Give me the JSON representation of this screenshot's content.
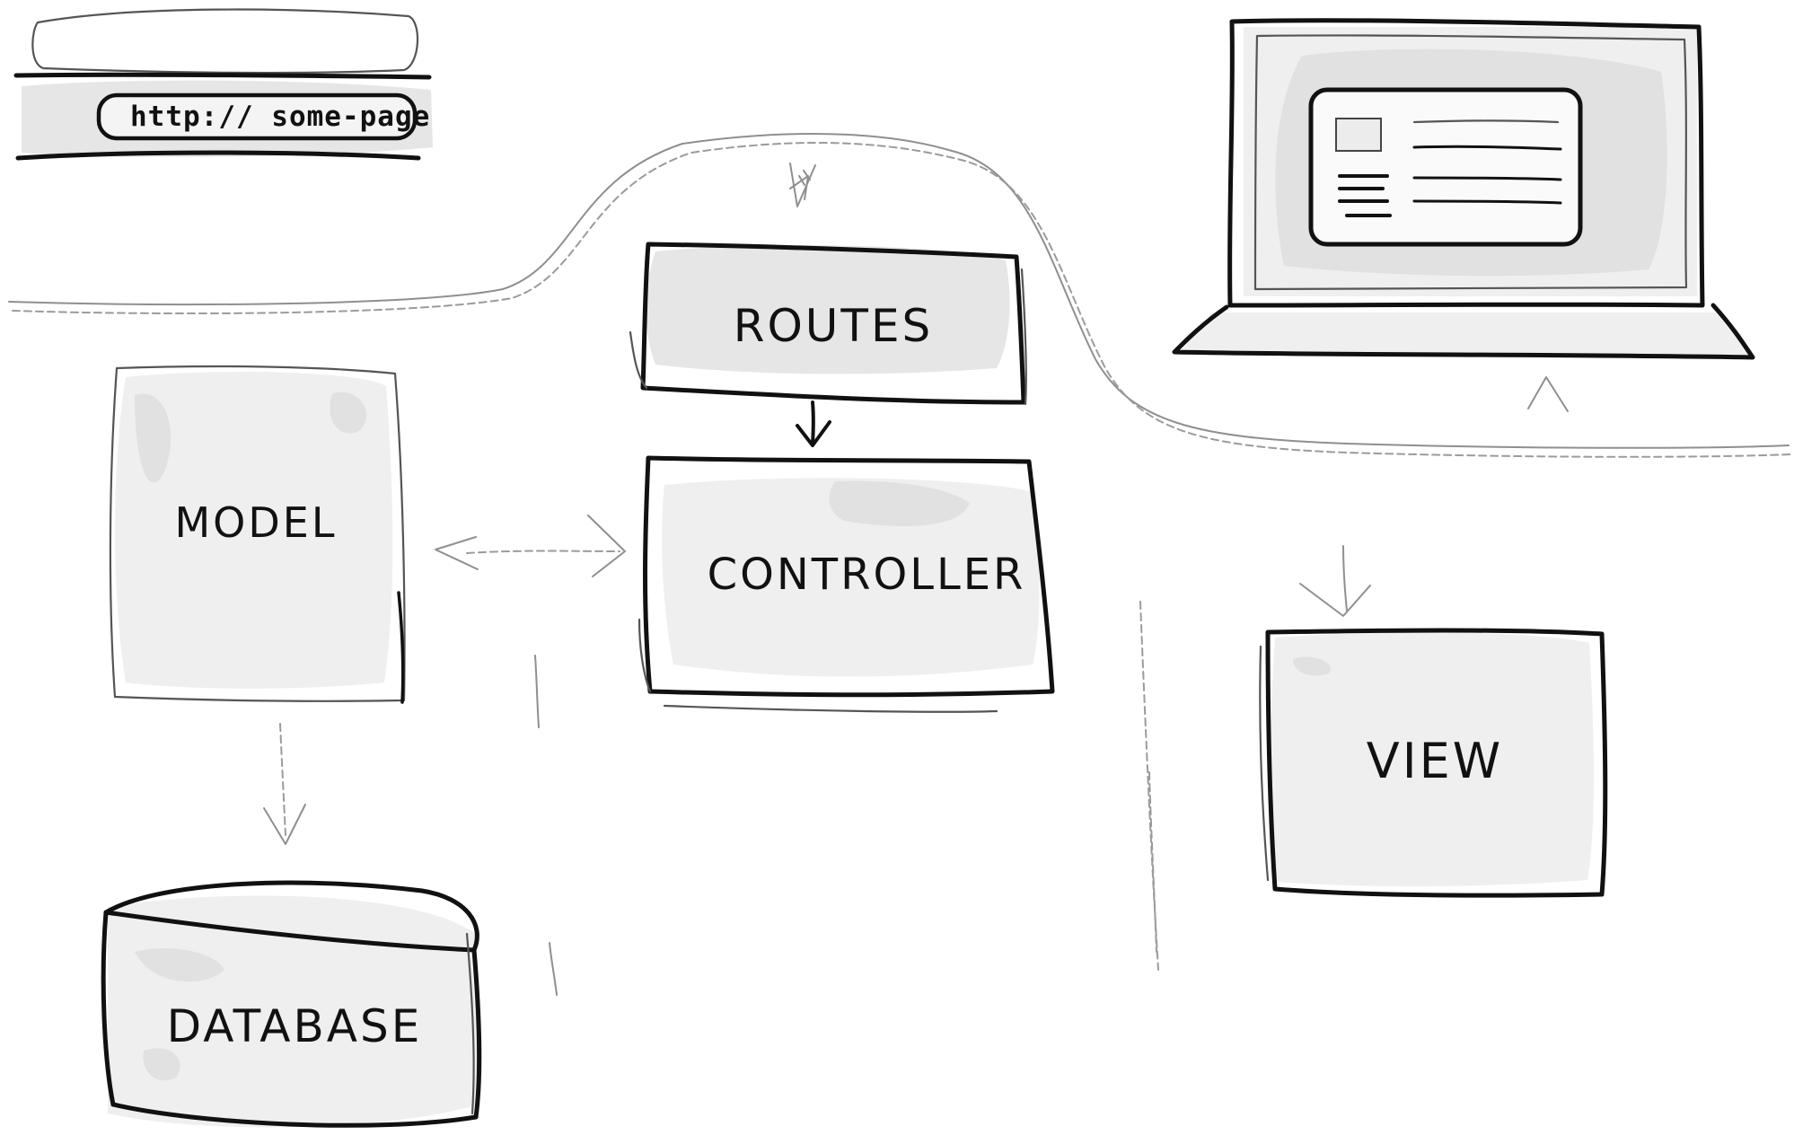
{
  "browser": {
    "url": "http:// some-page"
  },
  "nodes": {
    "model": "MODEL",
    "routes": "ROUTES",
    "controller": "CONTROLLER",
    "view": "VIEW",
    "database": "DATABASE"
  },
  "style": {
    "ink": "#111111",
    "shade": "#d8d8d8",
    "background": "#ffffff"
  }
}
